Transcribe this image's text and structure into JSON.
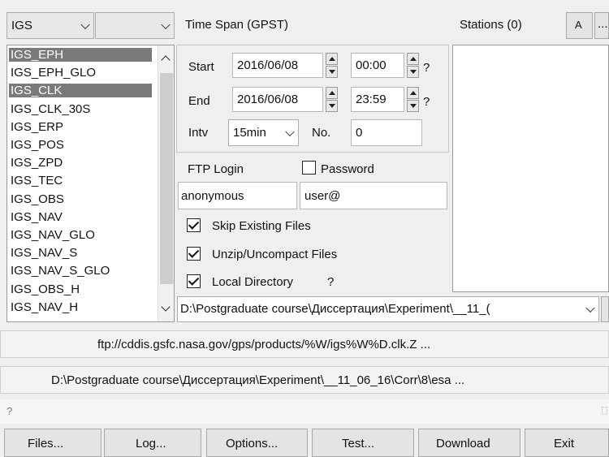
{
  "top_combos": {
    "source": "IGS",
    "sub": ""
  },
  "data_types": [
    {
      "label": "IGS_EPH",
      "selected": true
    },
    {
      "label": "IGS_EPH_GLO",
      "selected": false
    },
    {
      "label": "IGS_CLK",
      "selected": true
    },
    {
      "label": "IGS_CLK_30S",
      "selected": false
    },
    {
      "label": "IGS_ERP",
      "selected": false
    },
    {
      "label": "IGS_POS",
      "selected": false
    },
    {
      "label": "IGS_ZPD",
      "selected": false
    },
    {
      "label": "IGS_TEC",
      "selected": false
    },
    {
      "label": "IGS_OBS",
      "selected": false
    },
    {
      "label": "IGS_NAV",
      "selected": false
    },
    {
      "label": "IGS_NAV_GLO",
      "selected": false
    },
    {
      "label": "IGS_NAV_S",
      "selected": false
    },
    {
      "label": "IGS_NAV_S_GLO",
      "selected": false
    },
    {
      "label": "IGS_OBS_H",
      "selected": false
    },
    {
      "label": "IGS_NAV_H",
      "selected": false
    }
  ],
  "time_span": {
    "title": "Time Span (GPST)",
    "start_label": "Start",
    "start_date": "2016/06/08",
    "start_time": "00:00",
    "end_label": "End",
    "end_date": "2016/06/08",
    "end_time": "23:59",
    "help": "?",
    "intv_label": "Intv",
    "intv_value": "15min",
    "no_label": "No.",
    "no_value": "0"
  },
  "ftp": {
    "login_label": "FTP Login",
    "password_label": "Password",
    "user": "anonymous",
    "password": "user@"
  },
  "options": {
    "skip_existing": "Skip Existing Files",
    "unzip": "Unzip/Uncompact Files",
    "local_dir": "Local Directory",
    "local_help": "?"
  },
  "stations": {
    "title": "Stations (0)",
    "a_button": "A",
    "more_button": "..."
  },
  "directory_combo": "D:\\Postgraduate course\\Диссертация\\Experiment\\__11_(",
  "url_bar": "ftp://cddis.gsfc.nasa.gov/gps/products/%W/igs%W%D.clk.Z ...",
  "path_bar": "D:\\Postgraduate course\\Диссертация\\Experiment\\__11_06_16\\Corr\\8\\esa ...",
  "status_text": "?",
  "buttons": {
    "files": "Files...",
    "log": "Log...",
    "options": "Options...",
    "test": "Test...",
    "download": "Download",
    "exit": "Exit"
  }
}
